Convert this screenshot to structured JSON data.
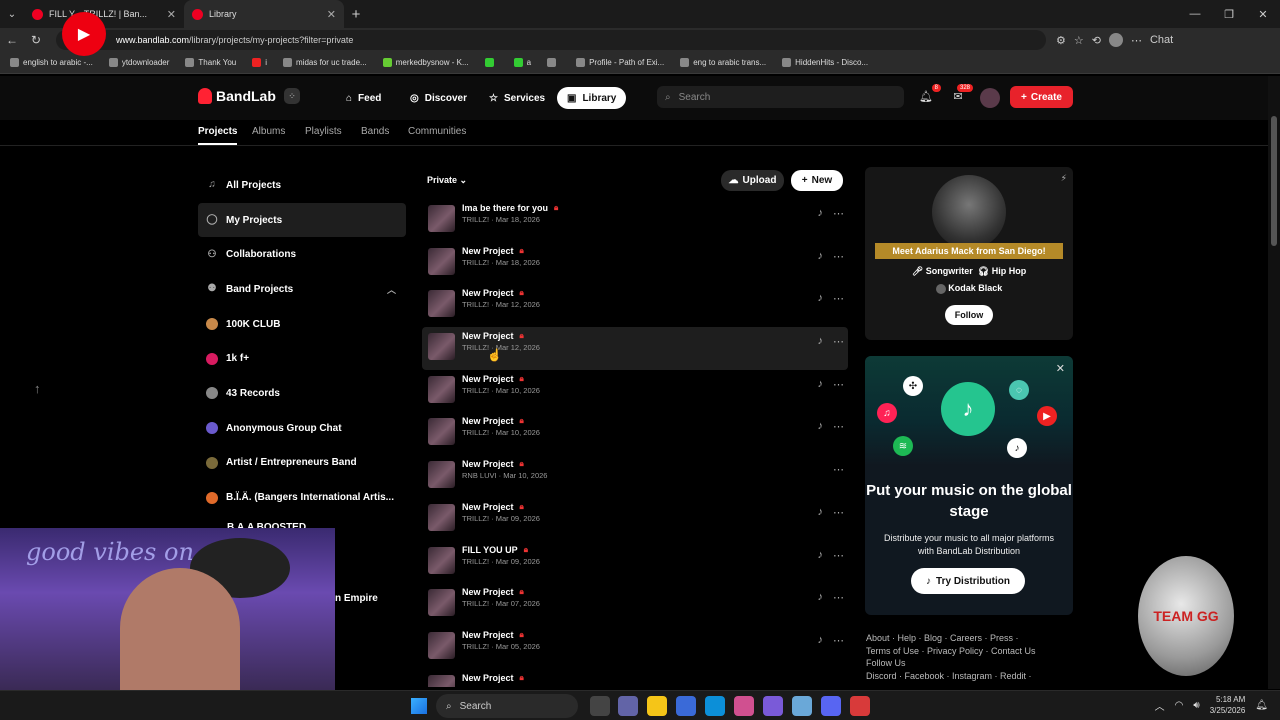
{
  "browser": {
    "tabs": [
      {
        "label": "FILL Y... TRILLZ! | Ban..."
      },
      {
        "label": "Library"
      }
    ],
    "new_tab": "+",
    "url_domain": "www.bandlab.com",
    "url_path": "/library/projects/my-projects?filter=private",
    "copilot_label": "Chat",
    "bookmarks": [
      {
        "label": "english to arabic -..."
      },
      {
        "label": "ytdownloader"
      },
      {
        "label": "Thank You"
      },
      {
        "label": "i"
      },
      {
        "label": "midas for uc trade..."
      },
      {
        "label": "merkedbysnow - K..."
      },
      {
        "label": ""
      },
      {
        "label": "a"
      },
      {
        "label": ""
      },
      {
        "label": "Profile - Path of Exi..."
      },
      {
        "label": "eng to arabic trans..."
      },
      {
        "label": "HiddenHits - Disco..."
      }
    ]
  },
  "header": {
    "logo": "BandLab",
    "nav": [
      {
        "label": "Feed"
      },
      {
        "label": "Discover"
      },
      {
        "label": "Services"
      },
      {
        "label": "Library"
      }
    ],
    "search_placeholder": "Search",
    "notif_count": "8",
    "msg_count": "328",
    "create_label": "Create"
  },
  "subtabs": [
    "Projects",
    "Albums",
    "Playlists",
    "Bands",
    "Communities"
  ],
  "sidebar": {
    "items": [
      {
        "label": "All Projects"
      },
      {
        "label": "My Projects"
      },
      {
        "label": "Collaborations"
      },
      {
        "label": "Band Projects"
      }
    ],
    "bands": [
      {
        "label": "100K CLUB",
        "color": "#c8894a"
      },
      {
        "label": "1k f+",
        "color": "#d81b60"
      },
      {
        "label": "43 Records",
        "color": "#888888"
      },
      {
        "label": "Anonymous Group Chat",
        "color": "#6a5acd"
      },
      {
        "label": "Artist / Entrepreneurs Band",
        "color": "#7a6a3a"
      },
      {
        "label": "B.Ï.Ä. (Bangers International Artis...",
        "color": "#e06a2a"
      }
    ],
    "partial_band": "B.A.A BOOSTED",
    "partial_empire": "n Empire"
  },
  "projects": {
    "filter": "Private",
    "upload_label": "Upload",
    "new_label": "New",
    "rows": [
      {
        "title": "Ima be there for you",
        "owner": "TRILLZ!",
        "date": "Mar 18, 2026"
      },
      {
        "title": "New Project",
        "owner": "TRILLZ!",
        "date": "Mar 18, 2026"
      },
      {
        "title": "New Project",
        "owner": "TRILLZ!",
        "date": "Mar 12, 2026"
      },
      {
        "title": "New Project",
        "owner": "TRILLZ!",
        "date": "Mar 12, 2026"
      },
      {
        "title": "New Project",
        "owner": "TRILLZ!",
        "date": "Mar 10, 2026"
      },
      {
        "title": "New Project",
        "owner": "TRILLZ!",
        "date": "Mar 10, 2026"
      },
      {
        "title": "New Project",
        "owner": "RNB LUVI",
        "date": "Mar 10, 2026"
      },
      {
        "title": "New Project",
        "owner": "TRILLZ!",
        "date": "Mar 09, 2026"
      },
      {
        "title": "FILL YOU UP",
        "owner": "TRILLZ!",
        "date": "Mar 09, 2026"
      },
      {
        "title": "New Project",
        "owner": "TRILLZ!",
        "date": "Mar 07, 2026"
      },
      {
        "title": "New Project",
        "owner": "TRILLZ!",
        "date": "Mar 05, 2026"
      },
      {
        "title": "New Project",
        "owner": "",
        "date": ""
      }
    ]
  },
  "artist_card": {
    "meet": "Meet Adarius Mack from San Diego!",
    "tag1": "Songwriter",
    "tag2": "Hip Hop",
    "similar": "Kodak Black",
    "follow": "Follow"
  },
  "promo": {
    "title": "Put your music on the global stage",
    "desc": "Distribute your music to all major platforms with BandLab Distribution",
    "button": "Try Distribution"
  },
  "footer": {
    "line1": "About · Help · Blog · Careers · Press ·",
    "line2": "Terms of Use · Privacy Policy · Contact Us",
    "line3": "Follow Us",
    "line4": "Discord · Facebook · Instagram · Reddit ·"
  },
  "overlay": {
    "neon_text": "good vibes on",
    "badge_text": "TEAM GG"
  },
  "taskbar": {
    "search": "Search",
    "time": "5:18 AM",
    "date": "3/25/2026"
  }
}
